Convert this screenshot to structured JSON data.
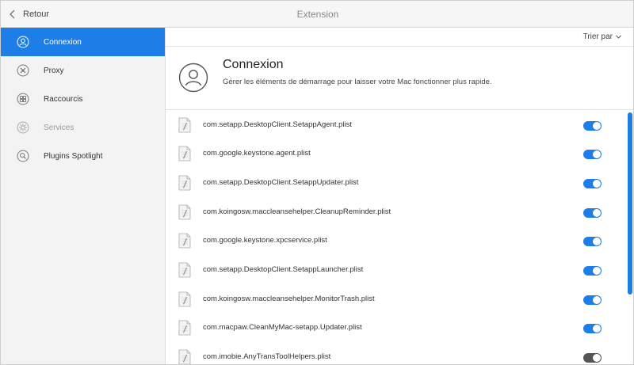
{
  "titlebar": {
    "back_label": "Retour",
    "title": "Extension"
  },
  "sidebar": {
    "items": [
      {
        "label": "Connexion",
        "icon": "user-circle-icon",
        "active": true
      },
      {
        "label": "Proxy",
        "icon": "proxy-icon"
      },
      {
        "label": "Raccourcis",
        "icon": "shortcuts-icon"
      },
      {
        "label": "Services",
        "icon": "services-icon",
        "disabled": true
      },
      {
        "label": "Plugins Spotlight",
        "icon": "search-icon"
      }
    ]
  },
  "main": {
    "sort_label": "Trier par",
    "header": {
      "title": "Connexion",
      "description": "Gérer les éléments de démarrage pour laisser votre Mac fonctionner plus rapide."
    },
    "items": [
      {
        "label": "com.setapp.DesktopClient.SetappAgent.plist",
        "enabled": true
      },
      {
        "label": "com.google.keystone.agent.plist",
        "enabled": true
      },
      {
        "label": "com.setapp.DesktopClient.SetappUpdater.plist",
        "enabled": true
      },
      {
        "label": "com.koingosw.maccleansehelper.CleanupReminder.plist",
        "enabled": true
      },
      {
        "label": "com.google.keystone.xpcservice.plist",
        "enabled": true
      },
      {
        "label": "com.setapp.DesktopClient.SetappLauncher.plist",
        "enabled": true
      },
      {
        "label": "com.koingosw.maccleansehelper.MonitorTrash.plist",
        "enabled": true
      },
      {
        "label": "com.macpaw.CleanMyMac-setapp.Updater.plist",
        "enabled": true
      },
      {
        "label": "com.imobie.AnyTransToolHelpers.plist",
        "enabled": false
      }
    ]
  },
  "colors": {
    "accent": "#1e7ee8",
    "toggle_off": "#555555"
  }
}
